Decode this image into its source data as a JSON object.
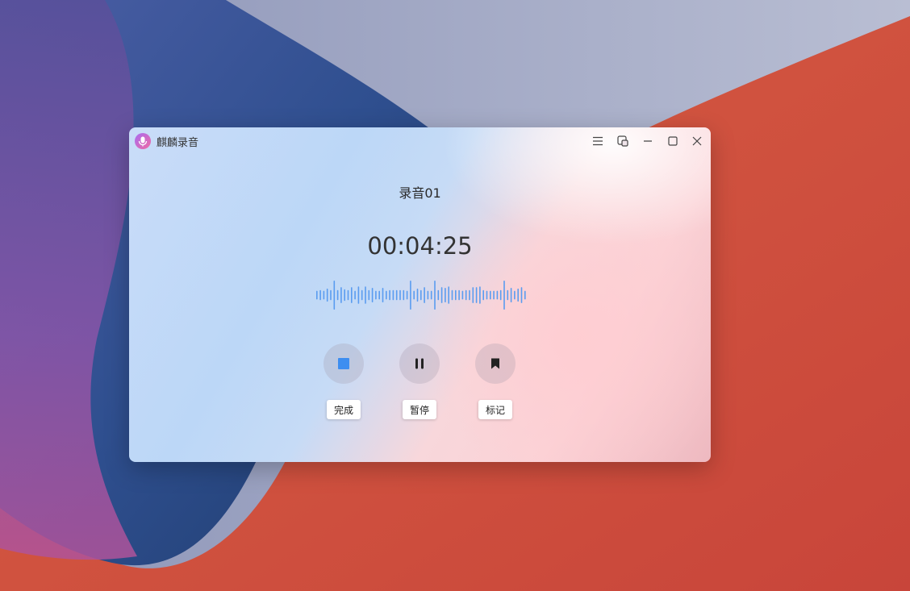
{
  "window": {
    "app_title": "麒麟录音"
  },
  "recording": {
    "name": "录音01",
    "elapsed": "00:04:25"
  },
  "controls": {
    "finish_label": "完成",
    "pause_label": "暂停",
    "mark_label": "标记"
  },
  "icons": {
    "app": "microphone-icon",
    "menu": "menu-icon",
    "mini_mode": "mini-mode-icon",
    "minimize": "minimize-icon",
    "maximize": "maximize-icon",
    "close": "close-icon",
    "finish": "stop-icon",
    "pause": "pause-icon",
    "mark": "bookmark-icon"
  },
  "colors": {
    "accent": "#3d8ef0",
    "waveform": "#5a9cf0"
  },
  "waveform_levels": [
    0.3,
    0.35,
    0.3,
    0.45,
    0.35,
    1.0,
    0.35,
    0.55,
    0.4,
    0.35,
    0.55,
    0.3,
    0.6,
    0.35,
    0.6,
    0.35,
    0.5,
    0.3,
    0.3,
    0.5,
    0.3,
    0.35,
    0.35,
    0.35,
    0.35,
    0.35,
    0.3,
    1.0,
    0.3,
    0.45,
    0.35,
    0.55,
    0.3,
    0.3,
    1.0,
    0.35,
    0.55,
    0.5,
    0.6,
    0.35,
    0.35,
    0.35,
    0.3,
    0.35,
    0.35,
    0.55,
    0.55,
    0.6,
    0.35,
    0.3,
    0.3,
    0.3,
    0.3,
    0.35,
    1.0,
    0.35,
    0.5,
    0.3,
    0.45,
    0.55,
    0.3
  ]
}
